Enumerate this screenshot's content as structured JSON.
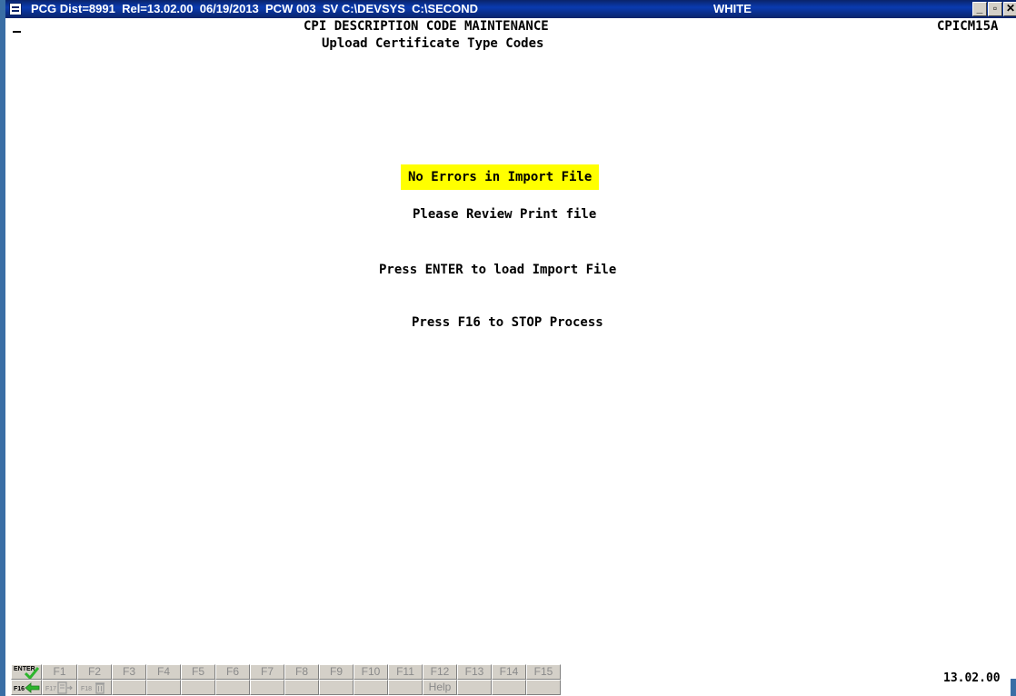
{
  "window": {
    "title": "PCG Dist=8991  Rel=13.02.00  06/19/2013  PCW 003  SV C:\\DEVSYS  C:\\SECOND",
    "workstation": "WHITE",
    "minimize_label": "_",
    "maximize_label": "▫",
    "close_label": "✕"
  },
  "screen": {
    "title": "CPI DESCRIPTION CODE MAINTENANCE",
    "subtitle": "Upload Certificate Type Codes",
    "program_id": "CPICM15A",
    "status_message": "No Errors in Import File",
    "review_message": "Please Review Print file",
    "enter_prompt": "Press ENTER to load Import File",
    "stop_prompt": "Press F16 to STOP Process"
  },
  "function_keys": {
    "row1": [
      {
        "label": "ENTER",
        "icon": "checkmark-icon",
        "enabled": true
      },
      {
        "label": "F1",
        "enabled": false
      },
      {
        "label": "F2",
        "enabled": false
      },
      {
        "label": "F3",
        "enabled": false
      },
      {
        "label": "F4",
        "enabled": false
      },
      {
        "label": "F5",
        "enabled": false
      },
      {
        "label": "F6",
        "enabled": false
      },
      {
        "label": "F7",
        "enabled": false
      },
      {
        "label": "F8",
        "enabled": false
      },
      {
        "label": "F9",
        "enabled": false
      },
      {
        "label": "F10",
        "enabled": false
      },
      {
        "label": "F11",
        "enabled": false
      },
      {
        "label": "F12",
        "enabled": false
      },
      {
        "label": "F13",
        "enabled": false
      },
      {
        "label": "F14",
        "enabled": false
      },
      {
        "label": "F15",
        "enabled": false
      }
    ],
    "row2": [
      {
        "label": "F16",
        "icon": "exit-arrow-icon",
        "enabled": true
      },
      {
        "label": "F17",
        "icon": "print-icon",
        "enabled": false
      },
      {
        "label": "F18",
        "icon": "trash-icon",
        "enabled": false
      },
      {
        "label": "",
        "enabled": false
      },
      {
        "label": "",
        "enabled": false
      },
      {
        "label": "",
        "enabled": false
      },
      {
        "label": "",
        "enabled": false
      },
      {
        "label": "",
        "enabled": false
      },
      {
        "label": "",
        "enabled": false
      },
      {
        "label": "",
        "enabled": false
      },
      {
        "label": "",
        "enabled": false
      },
      {
        "label": "",
        "enabled": false
      },
      {
        "label": "Help",
        "enabled": false
      },
      {
        "label": "",
        "enabled": false
      },
      {
        "label": "",
        "enabled": false
      },
      {
        "label": "",
        "enabled": false
      }
    ],
    "accent_enabled": "#1f9a1f",
    "enter_check_color": "#2db52d"
  },
  "version": "13.02.00",
  "colors": {
    "titlebar": "#0a246a",
    "highlight": "#ffff00",
    "button_face": "#d4d0c8"
  }
}
